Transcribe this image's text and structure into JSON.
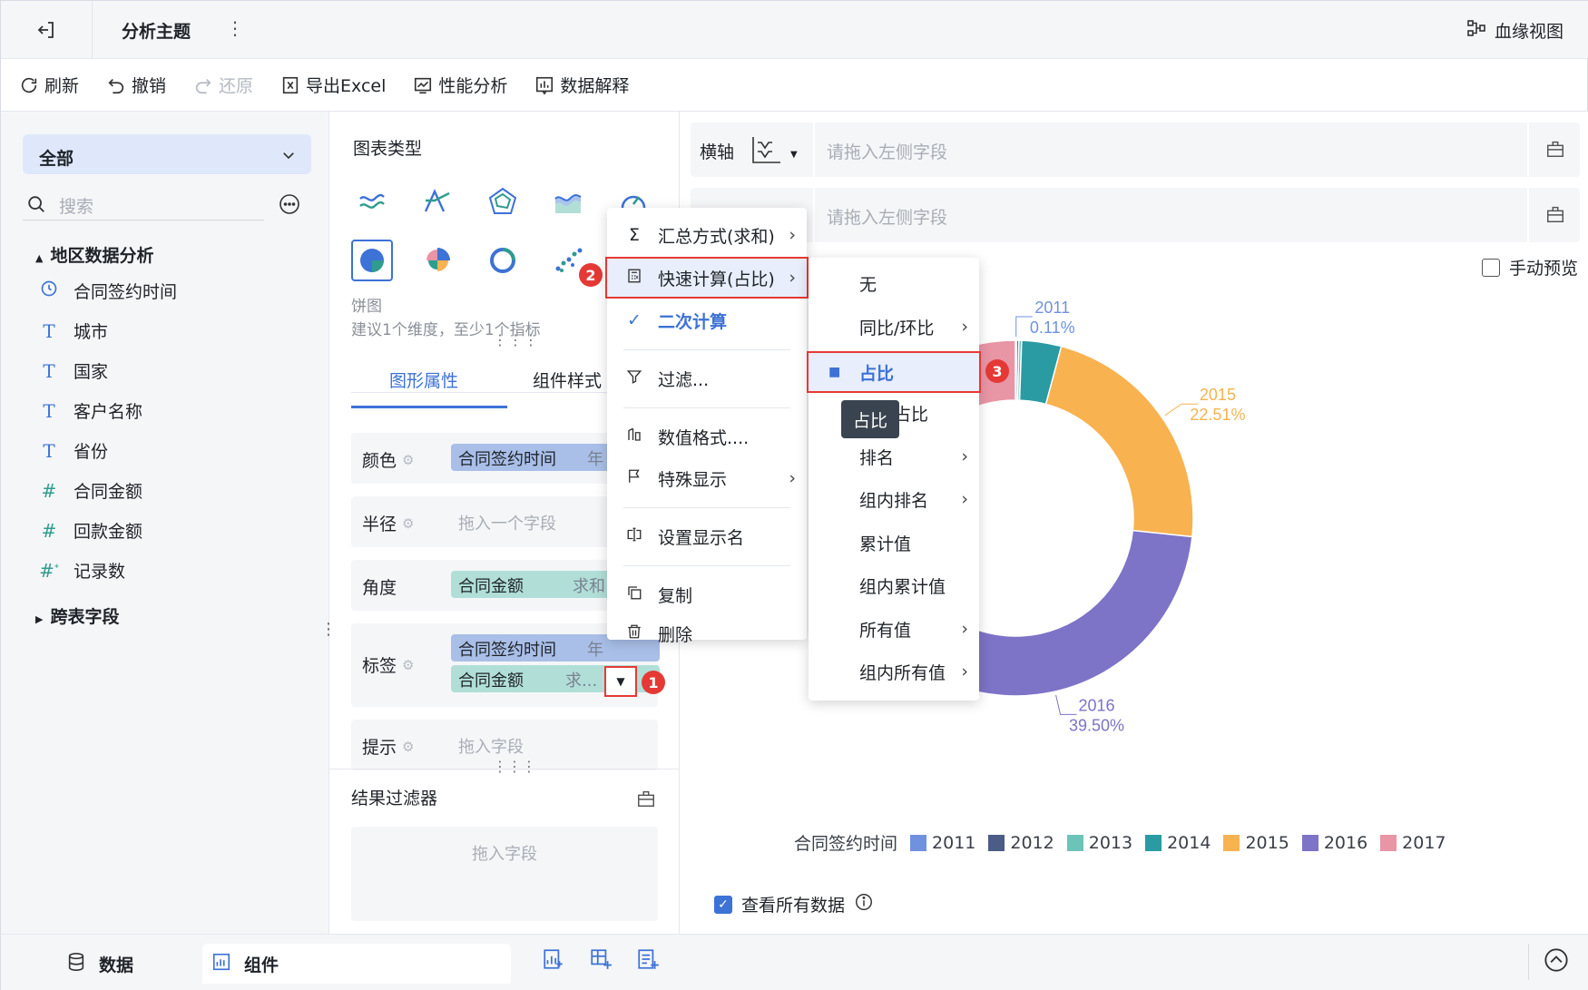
{
  "header": {
    "title": "分析主题",
    "lineage_label": "血缘视图"
  },
  "toolbar": {
    "refresh": "刷新",
    "undo": "撤销",
    "redo": "还原",
    "export": "导出Excel",
    "perf": "性能分析",
    "explain": "数据解释"
  },
  "left": {
    "scope": "全部",
    "search_placeholder": "搜索",
    "group": "地区数据分析",
    "fields": [
      {
        "name": "合同签约时间",
        "type": "time"
      },
      {
        "name": "城市",
        "type": "text"
      },
      {
        "name": "国家",
        "type": "text"
      },
      {
        "name": "客户名称",
        "type": "text"
      },
      {
        "name": "省份",
        "type": "text"
      },
      {
        "name": "合同金额",
        "type": "number"
      },
      {
        "name": "回款金额",
        "type": "number"
      },
      {
        "name": "记录数",
        "type": "count"
      }
    ],
    "cross_group": "跨表字段"
  },
  "middle": {
    "chart_type_label": "图表类型",
    "selected_chart": "饼图",
    "selected_hint": "建议1个维度，至少1个指标",
    "tabs": [
      "图形属性",
      "组件样式"
    ],
    "props": {
      "color": {
        "label": "颜色",
        "pill": "合同签约时间",
        "suffix": "年"
      },
      "radius": {
        "label": "半径",
        "placeholder": "拖入一个字段"
      },
      "angle": {
        "label": "角度",
        "pill": "合同金额",
        "suffix": "求和"
      },
      "tag": {
        "label": "标签",
        "pill1": "合同签约时间",
        "suffix1": "年",
        "pill2": "合同金额",
        "suffix2": "求..."
      },
      "tip": {
        "label": "提示",
        "placeholder": "拖入字段"
      }
    },
    "result_filter": {
      "title": "结果过滤器",
      "placeholder": "拖入字段"
    }
  },
  "right": {
    "x_axis": {
      "label": "横轴",
      "placeholder": "请拖入左侧字段"
    },
    "y_axis": {
      "label": "纵轴",
      "placeholder": "请拖入左侧字段"
    },
    "manual_preview": "手动预览",
    "view_all": "查看所有数据"
  },
  "badges": [
    "1",
    "2",
    "3"
  ],
  "context_menu": {
    "items": [
      {
        "label": "汇总方式(求和)",
        "icon": "sigma-icon",
        "submenu": true
      },
      {
        "label": "快速计算(占比)",
        "icon": "calculator-icon",
        "submenu": true
      },
      {
        "label": "二次计算",
        "icon": "check-icon",
        "submenu": false
      },
      {
        "label": "过滤...",
        "icon": "filter-icon",
        "submenu": false
      },
      {
        "label": "数值格式....",
        "icon": "format-icon",
        "submenu": false
      },
      {
        "label": "特殊显示",
        "icon": "flag-icon",
        "submenu": true
      },
      {
        "label": "设置显示名",
        "icon": "rename-icon",
        "submenu": false
      },
      {
        "label": "复制",
        "icon": "copy-icon",
        "submenu": false
      },
      {
        "label": "删除",
        "icon": "trash-icon",
        "submenu": false
      }
    ]
  },
  "sub_menu": {
    "items": [
      {
        "label": "无",
        "submenu": false
      },
      {
        "label": "同比/环比",
        "submenu": true
      },
      {
        "label": "占比",
        "submenu": false,
        "selected": true
      },
      {
        "label": "组内占比",
        "submenu": false
      },
      {
        "label": "排名",
        "submenu": true
      },
      {
        "label": "组内排名",
        "submenu": true
      },
      {
        "label": "累计值",
        "submenu": false
      },
      {
        "label": "组内累计值",
        "submenu": false
      },
      {
        "label": "所有值",
        "submenu": true
      },
      {
        "label": "组内所有值",
        "submenu": true
      }
    ],
    "tooltip": "占比"
  },
  "bottom": {
    "data_tab": "数据",
    "component_tab": "组件"
  },
  "chart_data": {
    "type": "pie",
    "legend_title": "合同签约时间",
    "categories": [
      "2011",
      "2012",
      "2013",
      "2014",
      "2015",
      "2016",
      "2017"
    ],
    "values": [
      0.11,
      0.2,
      0.25,
      3.6,
      22.51,
      39.5,
      33.83
    ],
    "colors": [
      "#7091e0",
      "#4b5d86",
      "#6cc4b8",
      "#2a9ba2",
      "#f8b250",
      "#7d73c7",
      "#e895a5"
    ],
    "visible_labels": [
      {
        "category": "2011",
        "percent": "0.11%"
      },
      {
        "category": "2015",
        "percent": "22.51%"
      },
      {
        "category": "2016",
        "percent": "39.50%"
      }
    ],
    "legend_position": "bottom"
  }
}
